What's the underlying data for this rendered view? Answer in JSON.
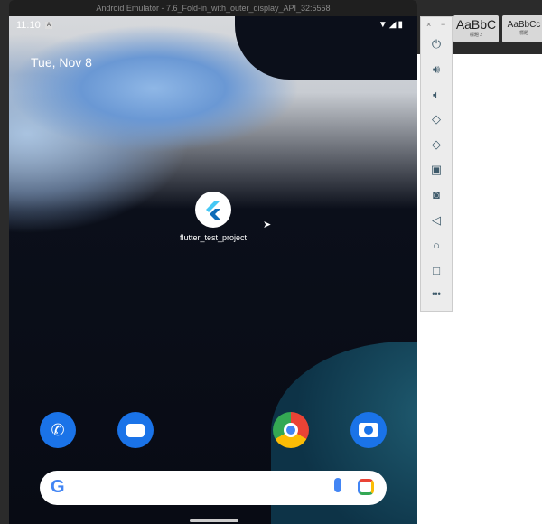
{
  "window": {
    "title": "Android Emulator - 7.6_Fold-in_with_outer_display_API_32:5558"
  },
  "background_app": {
    "styles": [
      {
        "preview": "AaBbC",
        "name": "標題 2"
      },
      {
        "preview": "AaBbCc",
        "name": "標題"
      }
    ]
  },
  "status_bar": {
    "time": "11:10",
    "notification_icon": "A"
  },
  "home": {
    "date": "Tue, Nov 8",
    "app": {
      "label": "flutter_test_project",
      "icon": "flutter-icon"
    },
    "dock": [
      {
        "name": "phone",
        "color": "#1a73e8"
      },
      {
        "name": "messages",
        "color": "#1a73e8"
      },
      {
        "name": "chrome"
      },
      {
        "name": "camera",
        "color": "#1a73e8"
      }
    ]
  },
  "toolbar": {
    "close": "×",
    "minimize": "−",
    "items": [
      "power",
      "volume-up",
      "volume-down",
      "rotate-left",
      "rotate-right",
      "fold",
      "screenshot",
      "back",
      "home",
      "overview",
      "more"
    ],
    "more_label": "•••"
  }
}
